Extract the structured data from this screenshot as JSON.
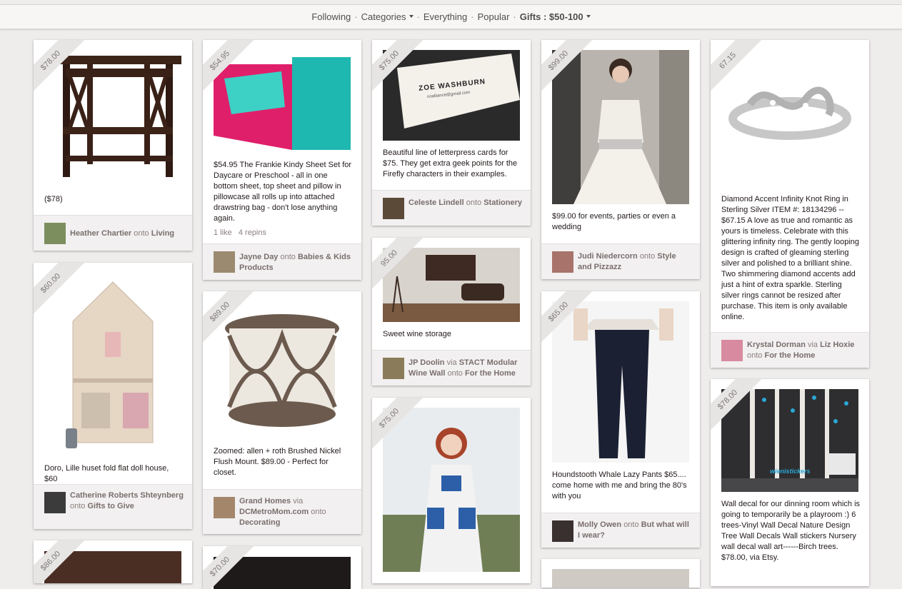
{
  "nav": {
    "following": "Following",
    "categories": "Categories",
    "everything": "Everything",
    "popular": "Popular",
    "gifts": "Gifts : $50-100",
    "sep": "·"
  },
  "pins": [
    {
      "price": "$78.00",
      "desc": "($78)",
      "user": "Heather Chartier",
      "onto": "onto",
      "board": "Living"
    },
    {
      "price": "$60.00",
      "desc": "Doro, Lille huset fold flat doll house, $60",
      "user": "Catherine Roberts Shteynberg",
      "onto": "onto",
      "board": "Gifts to Give"
    },
    {
      "price": "$86.00"
    },
    {
      "price": "$54.95",
      "desc": "$54.95 The Frankie Kindy Sheet Set for Daycare or Preschool - all in one bottom sheet, top sheet and pillow in pillowcase all rolls up into attached drawstring bag - don't lose anything again.",
      "likes": "1 like",
      "repins": "4 repins",
      "user": "Jayne Day",
      "onto": "onto",
      "board": "Babies & Kids Products"
    },
    {
      "price": "$89.00",
      "desc": "Zoomed: allen + roth Brushed Nickel Flush Mount. $89.00 - Perfect for closet.",
      "user": "Grand Homes",
      "via": "via",
      "source": "DCMetroMom.com",
      "onto": "onto",
      "board": "Decorating"
    },
    {
      "price": "$70.00"
    },
    {
      "price": "$75.00",
      "desc": "Beautiful line of letterpress cards for $75. They get extra geek points for the Firefly characters in their examples.",
      "card_name": "ZOE WASHBURN",
      "card_email": "noalliance@gmail.com",
      "user": "Celeste Lindell",
      "onto": "onto",
      "board": "Stationery"
    },
    {
      "price": "95.00",
      "desc": "Sweet wine storage",
      "user": "JP Doolin",
      "via": "via",
      "source": "STACT Modular Wine Wall",
      "onto": "onto",
      "board": "For the Home"
    },
    {
      "price": "$75.00"
    },
    {
      "price": "$99.00",
      "desc": "$99.00 for events, parties or even a wedding",
      "user": "Judi Niedercorn",
      "onto": "onto",
      "board": "Style and Pizzazz"
    },
    {
      "price": "$65.00",
      "desc": "Houndstooth Whale Lazy Pants $65.... come home with me and bring the 80's with you",
      "user": "Molly Owen",
      "onto": "onto",
      "board": "But what will I wear?"
    },
    {
      "price": "67.15",
      "desc": "Diamond Accent Infinity Knot Ring in Sterling Silver ITEM #: 18134296 -- $67.15 A love as true and romantic as yours is timeless. Celebrate with this glittering infinity ring. The gently looping design is crafted of gleaming sterling silver and polished to a brilliant shine. Two shimmering diamond accents add just a hint of extra sparkle. Sterling silver rings cannot be resized after purchase. This item is only available online.",
      "user": "Krystal Dorman",
      "via": "via",
      "source": "Liz Hoxie",
      "onto": "onto",
      "board": "For the Home"
    },
    {
      "price": "$78.00",
      "desc": "Wall decal for our dinning room which is going to temporarily be a playroom :) 6 trees-Vinyl Wall Decal Nature Design Tree Wall Decals Wall stickers Nursery wall decal wall art------Birch trees. $78.00, via Etsy.",
      "decal_text": "wienistickers"
    }
  ]
}
